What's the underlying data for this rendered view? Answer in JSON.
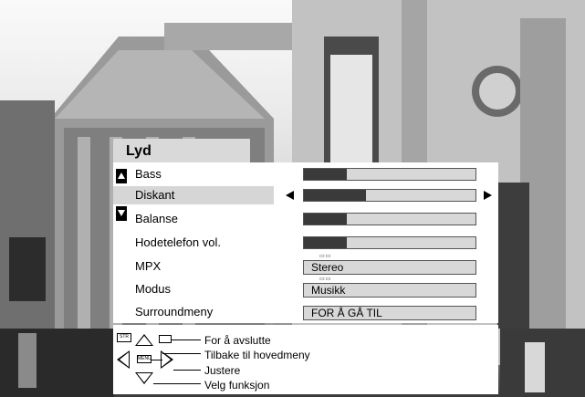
{
  "menu": {
    "title": "Lyd",
    "items": [
      {
        "label": "Bass",
        "type": "bar",
        "level": 0.25
      },
      {
        "label": "Diskant",
        "type": "bar",
        "level": 0.36,
        "selected": true
      },
      {
        "label": "Balanse",
        "type": "bar",
        "level": 0.25
      },
      {
        "label": "Hodetelefon vol.",
        "type": "bar",
        "level": 0.25
      },
      {
        "label": "MPX",
        "type": "value",
        "value": "Stereo"
      },
      {
        "label": "Modus",
        "type": "value",
        "value": "Musikk"
      },
      {
        "label": "Surroundmeny",
        "type": "value",
        "value": "FOR Å GÅ TIL"
      }
    ]
  },
  "help": {
    "exit": "For å avslutte",
    "back": "Tilbake til hovedmeny",
    "adjust": "Justere",
    "select": "Velg funksjon",
    "key_str": "STR",
    "key_menu": "MENU"
  },
  "icons": {
    "scroll_up": "up-triangle-icon",
    "scroll_down": "down-triangle-icon",
    "left": "left-arrow-icon",
    "right": "right-arrow-icon"
  },
  "colors": {
    "bar_fill": "#3a3a3a",
    "bar_track": "#d8d8d8",
    "highlight": "#d6d6d6"
  }
}
